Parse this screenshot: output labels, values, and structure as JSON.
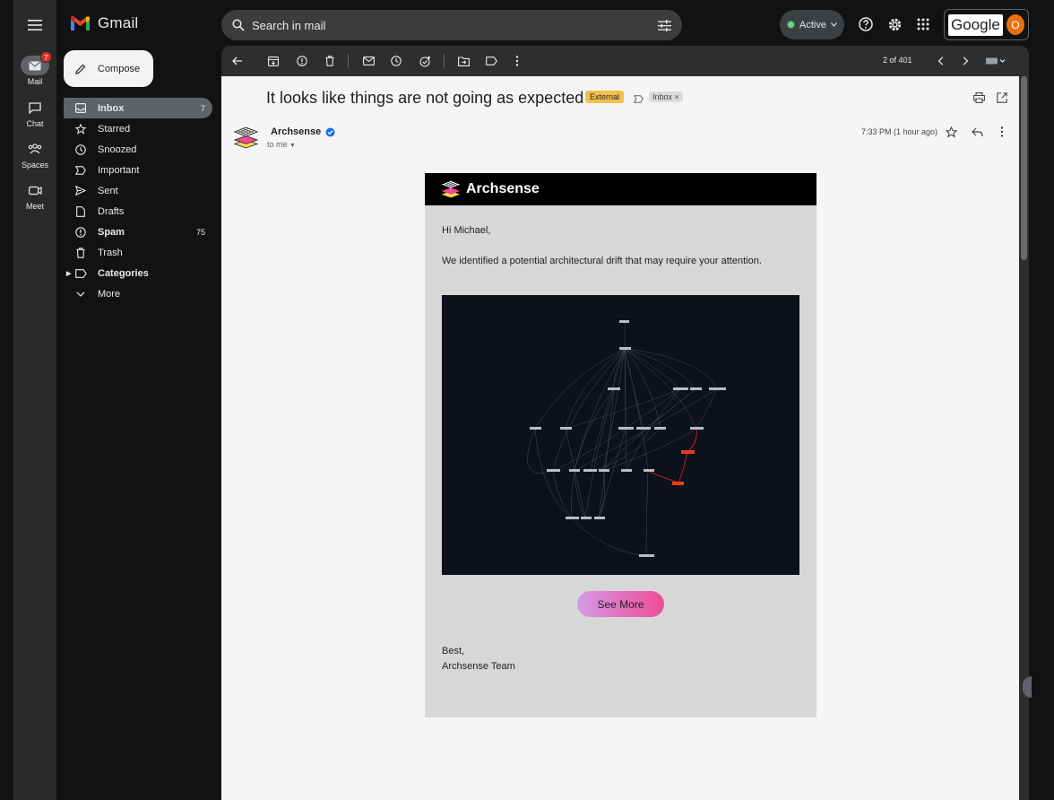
{
  "app": {
    "name": "Gmail"
  },
  "rail": {
    "items": [
      {
        "label": "Mail",
        "badge": "7"
      },
      {
        "label": "Chat"
      },
      {
        "label": "Spaces"
      },
      {
        "label": "Meet"
      }
    ]
  },
  "search": {
    "placeholder": "Search in mail"
  },
  "status": {
    "label": "Active"
  },
  "account": {
    "brand": "Google",
    "avatar_initial": "O"
  },
  "compose": {
    "label": "Compose"
  },
  "nav": {
    "items": [
      {
        "label": "Inbox",
        "count": "7"
      },
      {
        "label": "Starred"
      },
      {
        "label": "Snoozed"
      },
      {
        "label": "Important"
      },
      {
        "label": "Sent"
      },
      {
        "label": "Drafts"
      },
      {
        "label": "Spam",
        "count": "75"
      },
      {
        "label": "Trash"
      },
      {
        "label": "Categories"
      },
      {
        "label": "More"
      }
    ]
  },
  "toolbar": {
    "pager": "2 of 401"
  },
  "message": {
    "subject": "It looks like things are not going as expected",
    "labels": {
      "external": "External",
      "inbox": "Inbox",
      "remove": "×"
    },
    "sender": "Archsense",
    "recipient": "to me",
    "time": "7:33 PM (1 hour ago)"
  },
  "email": {
    "brand": "Archsense",
    "greeting": "Hi Michael,",
    "body": "We identified a potential architectural drift that may require your attention.",
    "cta": "See More",
    "signoff_line1": "Best,",
    "signoff_line2": "Archsense Team"
  },
  "colors": {
    "accent_external": "#f2c04d",
    "cta_gradient_start": "#d59ae8",
    "cta_gradient_end": "#ee4c95",
    "drift_node": "#e8401c",
    "graph_background": "#0c111b"
  }
}
